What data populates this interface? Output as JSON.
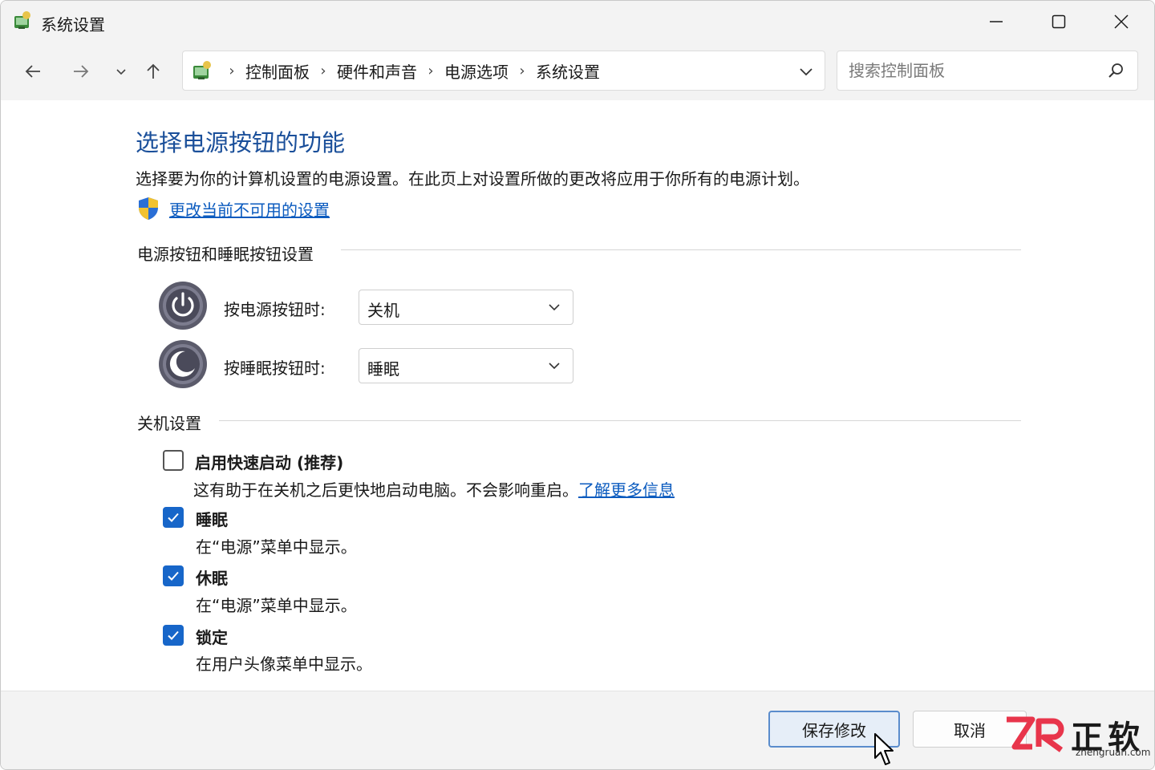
{
  "window": {
    "title": "系统设置",
    "app_icon": "control-panel-icon",
    "controls": [
      "minimize-icon",
      "maximize-icon",
      "close-icon"
    ]
  },
  "nav": {
    "back_icon": "arrow-left-icon",
    "forward_icon": "arrow-right-icon",
    "recent_icon": "chevron-down-icon",
    "up_icon": "arrow-up-icon",
    "breadcrumbs": [
      "控制面板",
      "硬件和声音",
      "电源选项",
      "系统设置"
    ],
    "search_placeholder": "搜索控制面板"
  },
  "main": {
    "title": "选择电源按钮的功能",
    "description": "选择要为你的计算机设置的电源设置。在此页上对设置所做的更改将应用于你所有的电源计划。",
    "change_link": "更改当前不可用的设置",
    "buttons_section": {
      "label": "电源按钮和睡眠按钮设置",
      "power_label": "按电源按钮时:",
      "power_value": "关机",
      "sleep_label": "按睡眠按钮时:",
      "sleep_value": "睡眠"
    },
    "shutdown_section": {
      "label": "关机设置",
      "items": [
        {
          "title": "启用快速启动 (推荐)",
          "desc": "这有助于在关机之后更快地启动电脑。不会影响重启。",
          "link": "了解更多信息",
          "checked": false
        },
        {
          "title": "睡眠",
          "desc": "在“电源”菜单中显示。",
          "checked": true
        },
        {
          "title": "休眠",
          "desc": "在“电源”菜单中显示。",
          "checked": true
        },
        {
          "title": "锁定",
          "desc": "在用户头像菜单中显示。",
          "checked": true
        }
      ]
    }
  },
  "footer": {
    "save_label": "保存修改",
    "cancel_label": "取消"
  },
  "watermark": {
    "title": "正软",
    "url": "zhengruan.com"
  },
  "colors": {
    "accent": "#1766c9",
    "title_blue": "#1a4f9a",
    "link": "#0b5bbf",
    "chrome": "#f3f3f3"
  }
}
